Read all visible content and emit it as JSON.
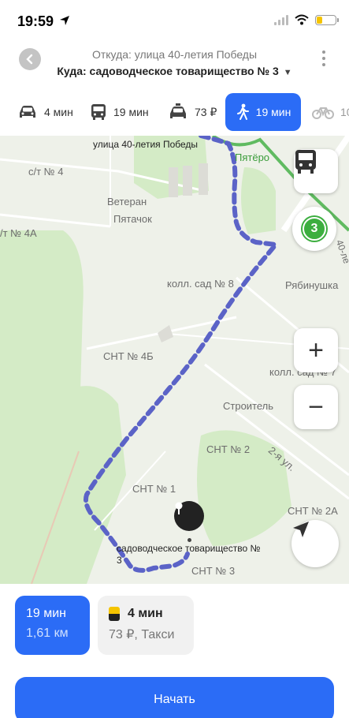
{
  "status_bar": {
    "time": "19:59",
    "icons": [
      "location-arrow-icon",
      "signal-icon",
      "wifi-icon",
      "battery-icon"
    ],
    "battery_color": "#f5c400"
  },
  "route": {
    "from_label": "Откуда: улица 40-летия Победы",
    "to_label": "Куда: садоводческое товарищество № 3",
    "to_caret": "▼"
  },
  "transport_tabs": [
    {
      "mode": "car",
      "icon": "car-icon",
      "label": "4 мин"
    },
    {
      "mode": "transit",
      "icon": "bus-icon",
      "label": "19 мин"
    },
    {
      "mode": "taxi",
      "icon": "taxi-icon",
      "label": "73 ₽"
    },
    {
      "mode": "walk",
      "icon": "walk-icon",
      "label": "19 мин",
      "active": true
    },
    {
      "mode": "bike",
      "icon": "bicycle-icon",
      "label": "10"
    }
  ],
  "map": {
    "labels": {
      "street_top": "улица 40-летия Победы",
      "pyaterochka": "Пятёро",
      "st4": "с/т № 4",
      "veteran": "Ветеран",
      "pyatachok": "Пятачок",
      "st4a": "/т № 4А",
      "kolsad8": "колл. сад № 8",
      "ryabinushka": "Рябинушка",
      "snt4b": "СНТ № 4Б",
      "kolsad7": "колл. сад № 7",
      "stroitel": "Строитель",
      "snt2": "СНТ № 2",
      "street2": "2-я ул.",
      "snt1": "СНТ № 1",
      "snt2a": "СНТ № 2А",
      "snt3": "СНТ № 3",
      "street40": "40-ле",
      "destination": "садоводческое товарищество № 3"
    },
    "transit_badge": "3",
    "accent_color": "#5b63c7",
    "transit_badge_color": "#3cae3f",
    "controls": {
      "zoom_in": "+",
      "zoom_out": "−"
    }
  },
  "options": {
    "walk": {
      "time": "19 мин",
      "distance": "1,61 км"
    },
    "taxi": {
      "time": "4 мин",
      "price": "73 ₽, Такси"
    }
  },
  "start_button": "Начать",
  "brand_color": "#2b6cf6"
}
